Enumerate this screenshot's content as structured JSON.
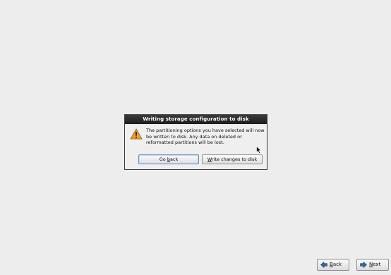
{
  "dialog": {
    "title": "Writing storage configuration to disk",
    "message": "The partitioning options you have selected will now be written to disk.  Any data on deleted or reformatted partitions will be lost.",
    "go_back_label_pre": "Go ",
    "go_back_label_mnemonic": "b",
    "go_back_label_post": "ack",
    "write_label_mnemonic": "W",
    "write_label_post": "rite changes to disk"
  },
  "navigation": {
    "back_label_mnemonic": "B",
    "back_label_post": "ack",
    "next_label_mnemonic": "N",
    "next_label_post": "ext"
  },
  "icons": {
    "warning": "warning-icon",
    "back": "back-arrow-icon",
    "next": "next-arrow-icon"
  },
  "colors": {
    "background": "#ededed",
    "title_bar": "#1c1c1c",
    "warning": "#f2a12b",
    "arrow": "#3465a4"
  }
}
